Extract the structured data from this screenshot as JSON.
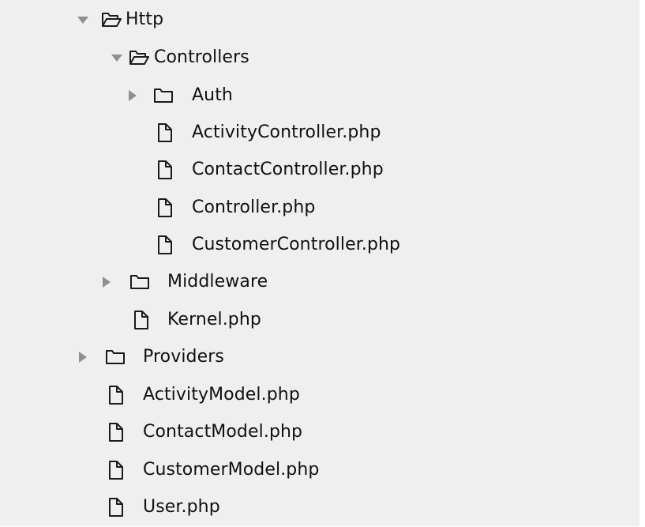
{
  "tree": {
    "http": {
      "label": "Http",
      "state": "expanded"
    },
    "controllers": {
      "label": "Controllers",
      "state": "expanded"
    },
    "auth": {
      "label": "Auth",
      "state": "collapsed"
    },
    "activity_controller": {
      "label": "ActivityController.php"
    },
    "contact_controller": {
      "label": "ContactController.php"
    },
    "controller": {
      "label": "Controller.php"
    },
    "customer_controller": {
      "label": "CustomerController.php"
    },
    "middleware": {
      "label": "Middleware",
      "state": "collapsed"
    },
    "kernel": {
      "label": "Kernel.php"
    },
    "providers": {
      "label": "Providers",
      "state": "collapsed"
    },
    "activity_model": {
      "label": "ActivityModel.php"
    },
    "contact_model": {
      "label": "ContactModel.php"
    },
    "customer_model": {
      "label": "CustomerModel.php"
    },
    "user": {
      "label": "User.php"
    }
  },
  "icons": {
    "expanded_arrow": "triangle-down-icon",
    "collapsed_arrow": "triangle-right-icon",
    "open_folder": "folder-open-icon",
    "closed_folder": "folder-icon",
    "file": "file-icon"
  },
  "colors": {
    "panel_background": "#efefef",
    "arrow": "#8f8f8f",
    "icon_stroke": "#1b1b1b",
    "text": "#111111"
  }
}
